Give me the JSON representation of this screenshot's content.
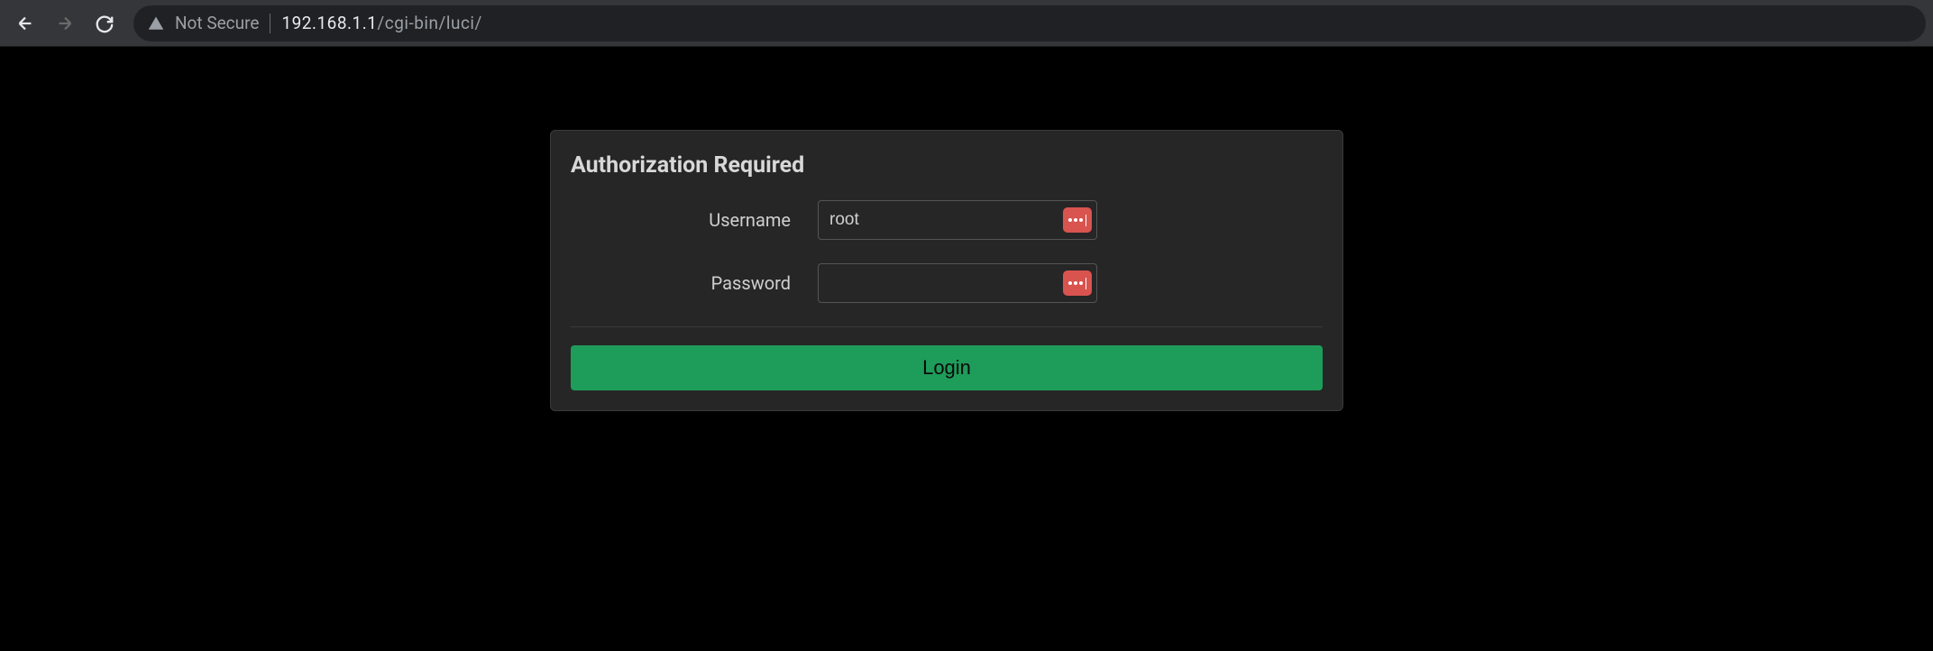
{
  "browser": {
    "security_label": "Not Secure",
    "url_host": "192.168.1.1",
    "url_path": "/cgi-bin/luci/"
  },
  "login": {
    "title": "Authorization Required",
    "username_label": "Username",
    "username_value": "root",
    "password_label": "Password",
    "password_value": "",
    "login_button": "Login"
  }
}
